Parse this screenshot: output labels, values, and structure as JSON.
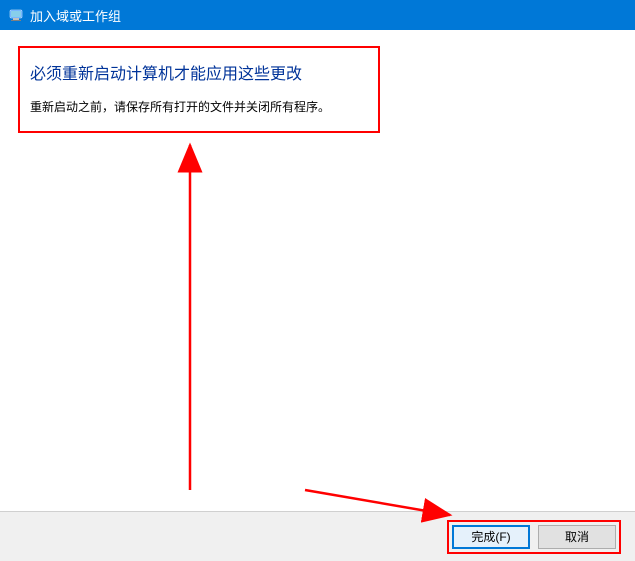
{
  "titlebar": {
    "title": "加入域或工作组"
  },
  "content": {
    "heading": "必须重新启动计算机才能应用这些更改",
    "subtext": "重新启动之前，请保存所有打开的文件并关闭所有程序。"
  },
  "footer": {
    "finish_label": "完成(F)",
    "cancel_label": "取消"
  }
}
